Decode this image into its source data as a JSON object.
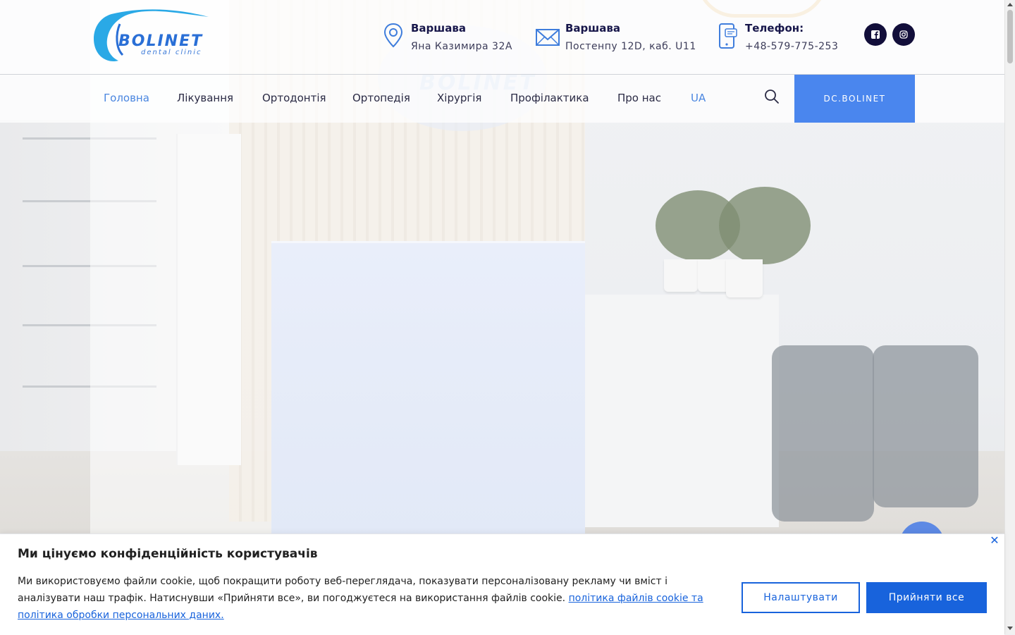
{
  "brand": {
    "name": "BOLINET",
    "tagline": "dental clinic",
    "logo_color": "#2a6fd6"
  },
  "contacts": [
    {
      "icon": "map-pin-icon",
      "title": "Варшава",
      "detail": "Яна Казимира 32А"
    },
    {
      "icon": "envelope-icon",
      "title": "Варшава",
      "detail": "Постенпу 12D, каб. U11"
    },
    {
      "icon": "phone-icon",
      "title": "Телефон:",
      "detail": "+48-579-775-253"
    }
  ],
  "social": [
    {
      "icon": "facebook-icon"
    },
    {
      "icon": "instagram-icon"
    }
  ],
  "nav": {
    "items": [
      "Головна",
      "Лікування",
      "Ортодонтія",
      "Ортопедія",
      "Хірургія",
      "Профілактика",
      "Про нас",
      "UA"
    ],
    "active": "Головна",
    "cta": "DC.BOLINET",
    "accent": "#4a86e0"
  },
  "cookie": {
    "title": "Ми цінуємо конфіденційність користувачів",
    "text": "Ми використовуємо файли cookie, щоб покращити роботу веб-переглядача, показувати персоналізовану рекламу чи вміст і аналізувати наш трафік. Натиснувши «Прийняти все», ви погоджуєтеся на використання файлів cookie.",
    "link": "політика файлів cookie та політика обробки персональних даних.",
    "customize": "Налаштувати",
    "accept": "Прийняти все",
    "close": "✕",
    "accent": "#1863dc"
  }
}
